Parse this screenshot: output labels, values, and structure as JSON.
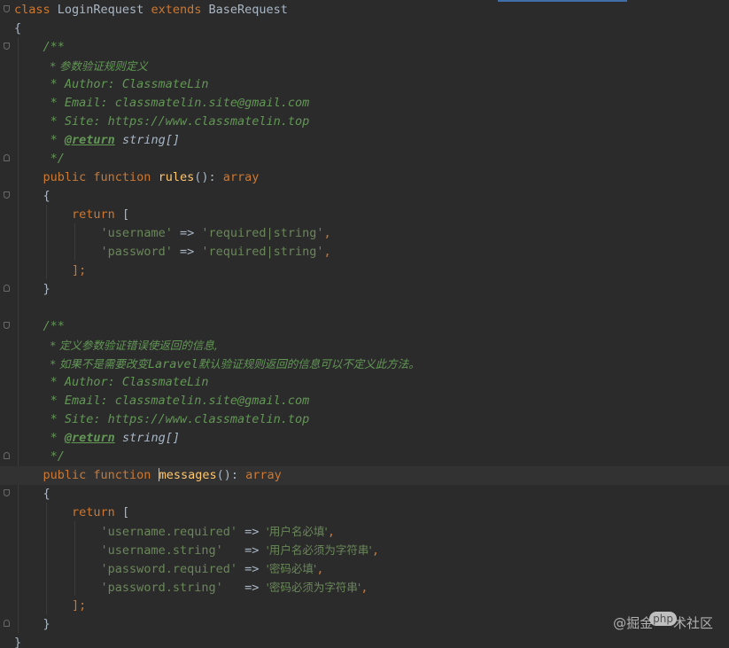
{
  "colors": {
    "background": "#2b2b2b",
    "keyword": "#cc7832",
    "function": "#ffc66d",
    "string": "#6a8759",
    "doc_comment": "#629755",
    "plain": "#a9b7c6"
  },
  "code": {
    "class_line": {
      "kw1": "class",
      "name": "LoginRequest",
      "kw2": "extends",
      "parent": "BaseRequest"
    },
    "open_brace": "{",
    "close_brace": "}",
    "rules_doc": {
      "start": "/**",
      "line1": "* 参数验证规则定义",
      "line2": "* Author: ClassmateLin",
      "line3": "* Email: classmatelin.site@gmail.com",
      "line4": "* Site: https://www.classmatelin.top",
      "return_star": "* ",
      "return_tag": "@return",
      "return_type": " string[]",
      "end": "*/"
    },
    "rules_fn": {
      "kw": "public function",
      "name": "rules",
      "rest": "(): ",
      "type": "array"
    },
    "rules_open": "{",
    "rules_return": {
      "kw": "return",
      "bracket": " ["
    },
    "rules_items": [
      {
        "key": "'username'",
        "arrow": " => ",
        "value": "'required|string'",
        "comma": ","
      },
      {
        "key": "'password'",
        "arrow": " => ",
        "value": "'required|string'",
        "comma": ","
      }
    ],
    "rules_end": "];",
    "rules_close": "}",
    "messages_doc": {
      "start": "/**",
      "line1": "* 定义参数验证错误使返回的信息,",
      "line2a": "* 如果不是需要改变",
      "line2b": "Laravel",
      "line2c": "默认验证规则返回的信息可以不定义此方法。",
      "line3": "* Author: ClassmateLin",
      "line4": "* Email: classmatelin.site@gmail.com",
      "line5": "* Site: https://www.classmatelin.top",
      "return_star": "* ",
      "return_tag": "@return",
      "return_type": " string[]",
      "end": "*/"
    },
    "messages_fn": {
      "kw": "public function",
      "name": "messages",
      "rest": "(): ",
      "type": "array"
    },
    "messages_open": "{",
    "messages_return": {
      "kw": "return",
      "bracket": " ["
    },
    "messages_items": [
      {
        "key": "'username.required'",
        "arrow": " => ",
        "value": "'用户名必填'",
        "comma": ","
      },
      {
        "key": "'username.string'  ",
        "arrow": " => ",
        "value": "'用户名必须为字符串'",
        "comma": ","
      },
      {
        "key": "'password.required'",
        "arrow": " => ",
        "value": "'密码必填'",
        "comma": ","
      },
      {
        "key": "'password.string'  ",
        "arrow": " => ",
        "value": "'密码必须为字符串'",
        "comma": ","
      }
    ],
    "messages_end": "];",
    "messages_close": "}"
  },
  "watermark": {
    "left": "@掘金",
    "badge": "php",
    "right": "术社区"
  }
}
